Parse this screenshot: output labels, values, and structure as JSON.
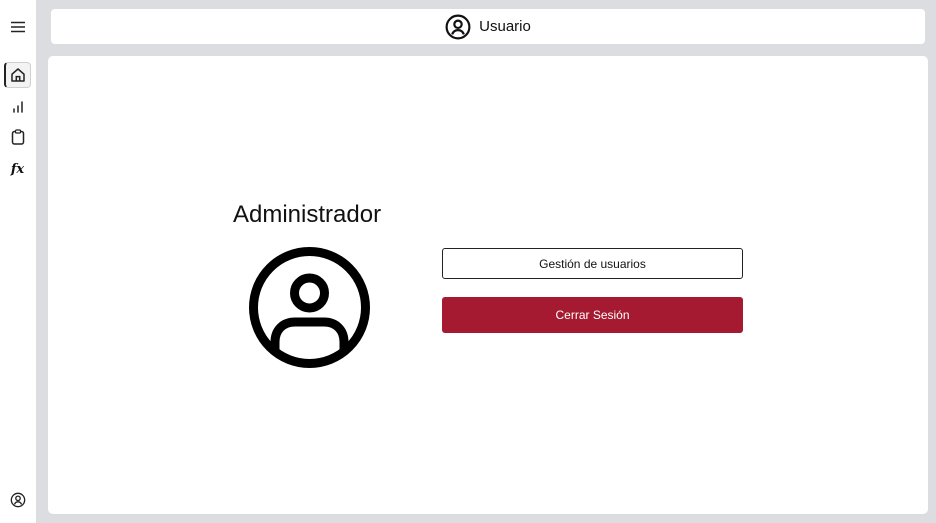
{
  "colors": {
    "accent_red": "#a51a30",
    "app_background": "#dcdde1",
    "panel_background": "#ffffff"
  },
  "sidebar": {
    "menu_icon": "hamburger-menu-icon",
    "items": [
      {
        "icon": "home-icon",
        "active": true
      },
      {
        "icon": "bar-chart-icon",
        "active": false
      },
      {
        "icon": "clipboard-icon",
        "active": false
      },
      {
        "icon": "function-icon",
        "glyph": "fx",
        "active": false
      }
    ],
    "footer_icon": "user-circle-icon"
  },
  "header": {
    "icon": "user-circle-icon",
    "title": "Usuario"
  },
  "main": {
    "role_title": "Administrador",
    "avatar_icon": "user-circle-icon",
    "buttons": {
      "manage_users": "Gestión de usuarios",
      "logout": "Cerrar Sesión"
    }
  }
}
